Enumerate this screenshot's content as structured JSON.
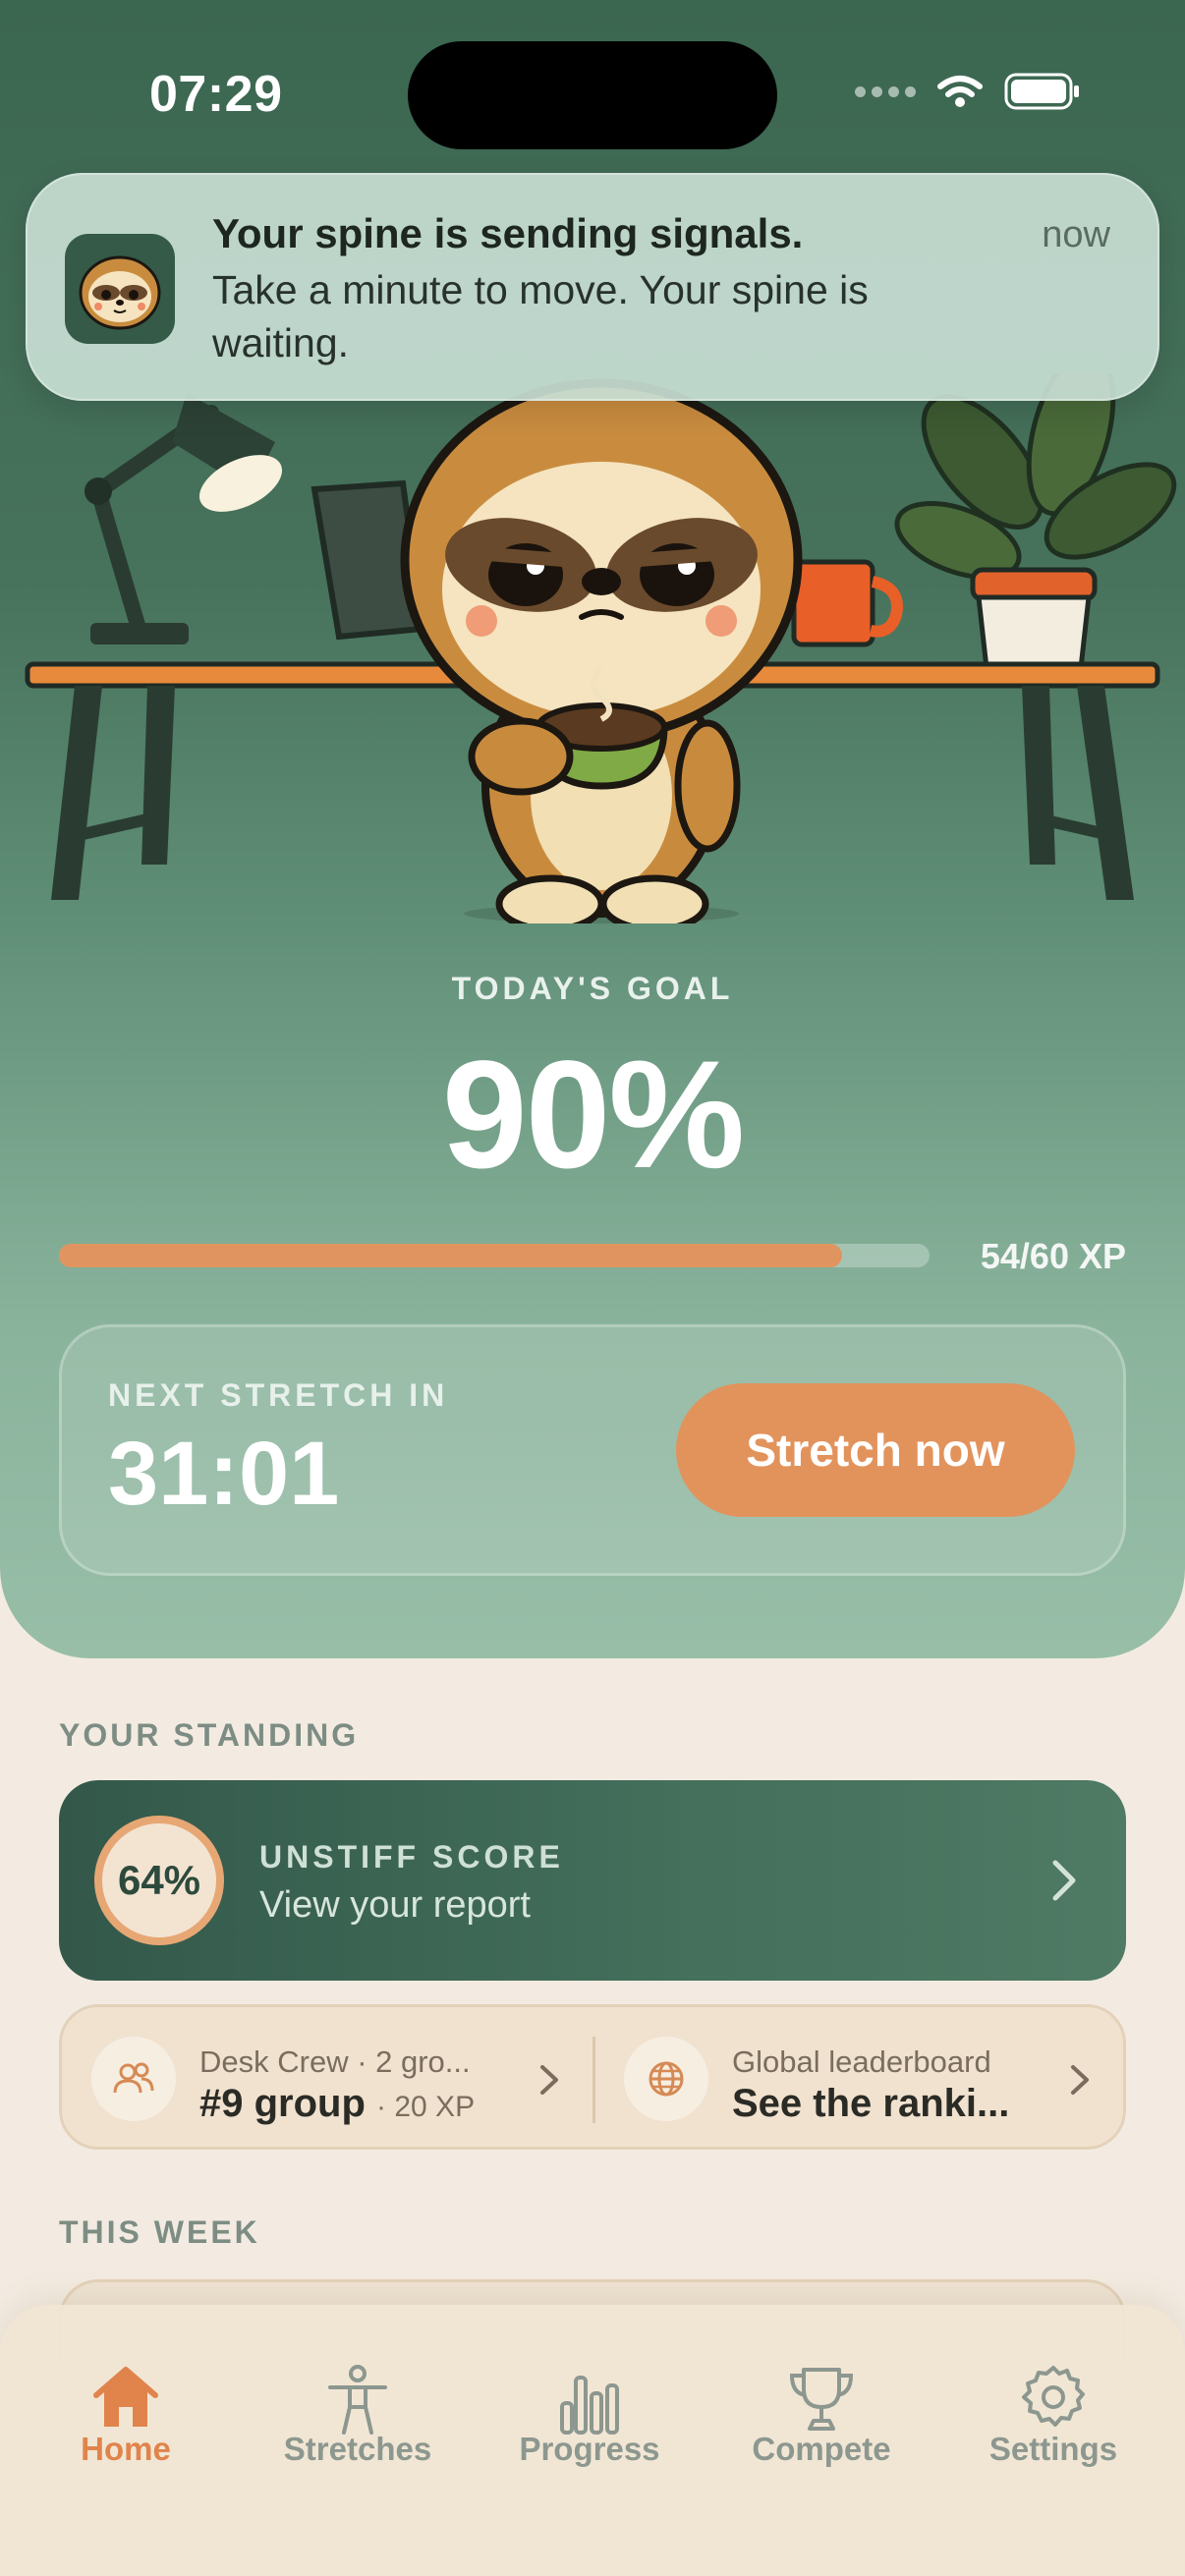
{
  "status_bar": {
    "time": "07:29"
  },
  "notification": {
    "title": "Your spine is sending signals.",
    "body": "Take a minute to move. Your spine is waiting.",
    "time": "now",
    "app_icon": "sloth-face-icon"
  },
  "goal": {
    "label": "TODAY'S GOAL",
    "percent": "90%",
    "xp_text": "54/60 XP",
    "xp_current": 54,
    "xp_max": 60
  },
  "next_stretch": {
    "label": "NEXT STRETCH IN",
    "time": "31:01",
    "button_label": "Stretch now"
  },
  "standing": {
    "section_label": "YOUR STANDING",
    "score": {
      "value": "64%",
      "title": "UNSTIFF SCORE",
      "subtitle": "View your report"
    },
    "group": {
      "small": "Desk Crew · 2 gro...",
      "rank": "#9 group",
      "xp": "· 20 XP",
      "icon": "people-icon"
    },
    "global": {
      "small": "Global leaderboard",
      "big": "See the ranki...",
      "icon": "globe-icon"
    }
  },
  "week": {
    "section_label": "THIS WEEK"
  },
  "tabs": [
    {
      "label": "Home",
      "icon": "home-icon",
      "active": true
    },
    {
      "label": "Stretches",
      "icon": "person-stretch-icon",
      "active": false
    },
    {
      "label": "Progress",
      "icon": "bar-chart-icon",
      "active": false
    },
    {
      "label": "Compete",
      "icon": "trophy-icon",
      "active": false
    },
    {
      "label": "Settings",
      "icon": "gear-icon",
      "active": false
    }
  ],
  "colors": {
    "accent": "#e2935c",
    "hero_dark": "#3b6650",
    "hero_light": "#98bea8",
    "background": "#f3ebe1",
    "tab_active": "#e0844c"
  }
}
